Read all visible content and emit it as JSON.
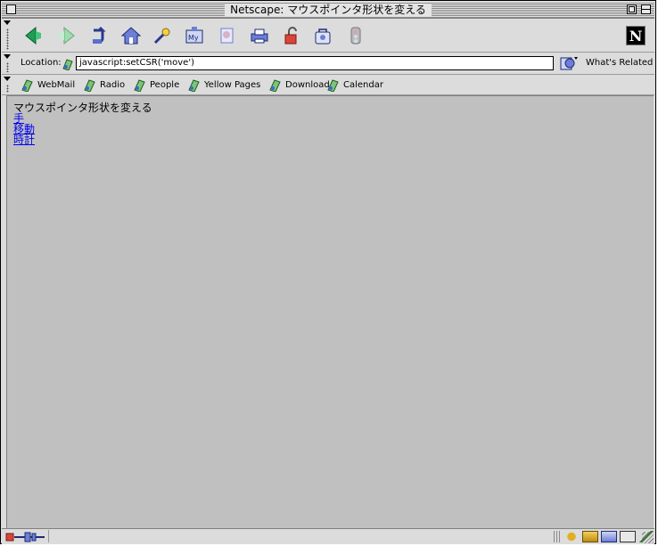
{
  "window": {
    "title": "Netscape: マウスポインタ形状を変える"
  },
  "toolbar": {
    "buttons": [
      {
        "name": "back-button",
        "icon": "back-arrow-icon"
      },
      {
        "name": "forward-button",
        "icon": "forward-arrow-icon"
      },
      {
        "name": "reload-button",
        "icon": "reload-icon"
      },
      {
        "name": "home-button",
        "icon": "home-icon"
      },
      {
        "name": "search-button",
        "icon": "search-icon"
      },
      {
        "name": "my-netscape-button",
        "icon": "my-netscape-icon"
      },
      {
        "name": "images-button",
        "icon": "images-icon"
      },
      {
        "name": "print-button",
        "icon": "print-icon"
      },
      {
        "name": "security-button",
        "icon": "lock-icon"
      },
      {
        "name": "shop-button",
        "icon": "shop-icon"
      },
      {
        "name": "stop-button",
        "icon": "stop-icon"
      }
    ],
    "logo_letter": "N"
  },
  "location": {
    "label": "Location:",
    "url": "javascript:setCSR('move')",
    "related_label": "What's Related"
  },
  "bookmarks": [
    {
      "label": "WebMail"
    },
    {
      "label": "Radio"
    },
    {
      "label": "People"
    },
    {
      "label": "Yellow Pages"
    },
    {
      "label": "Download"
    },
    {
      "label": "Calendar"
    }
  ],
  "page": {
    "heading": "マウスポインタ形状を変える",
    "links": [
      "手",
      "移動",
      "時計"
    ]
  },
  "colors": {
    "content_bg": "#c0c0c0",
    "link": "#0000ee",
    "chrome": "#dcdcdc"
  }
}
